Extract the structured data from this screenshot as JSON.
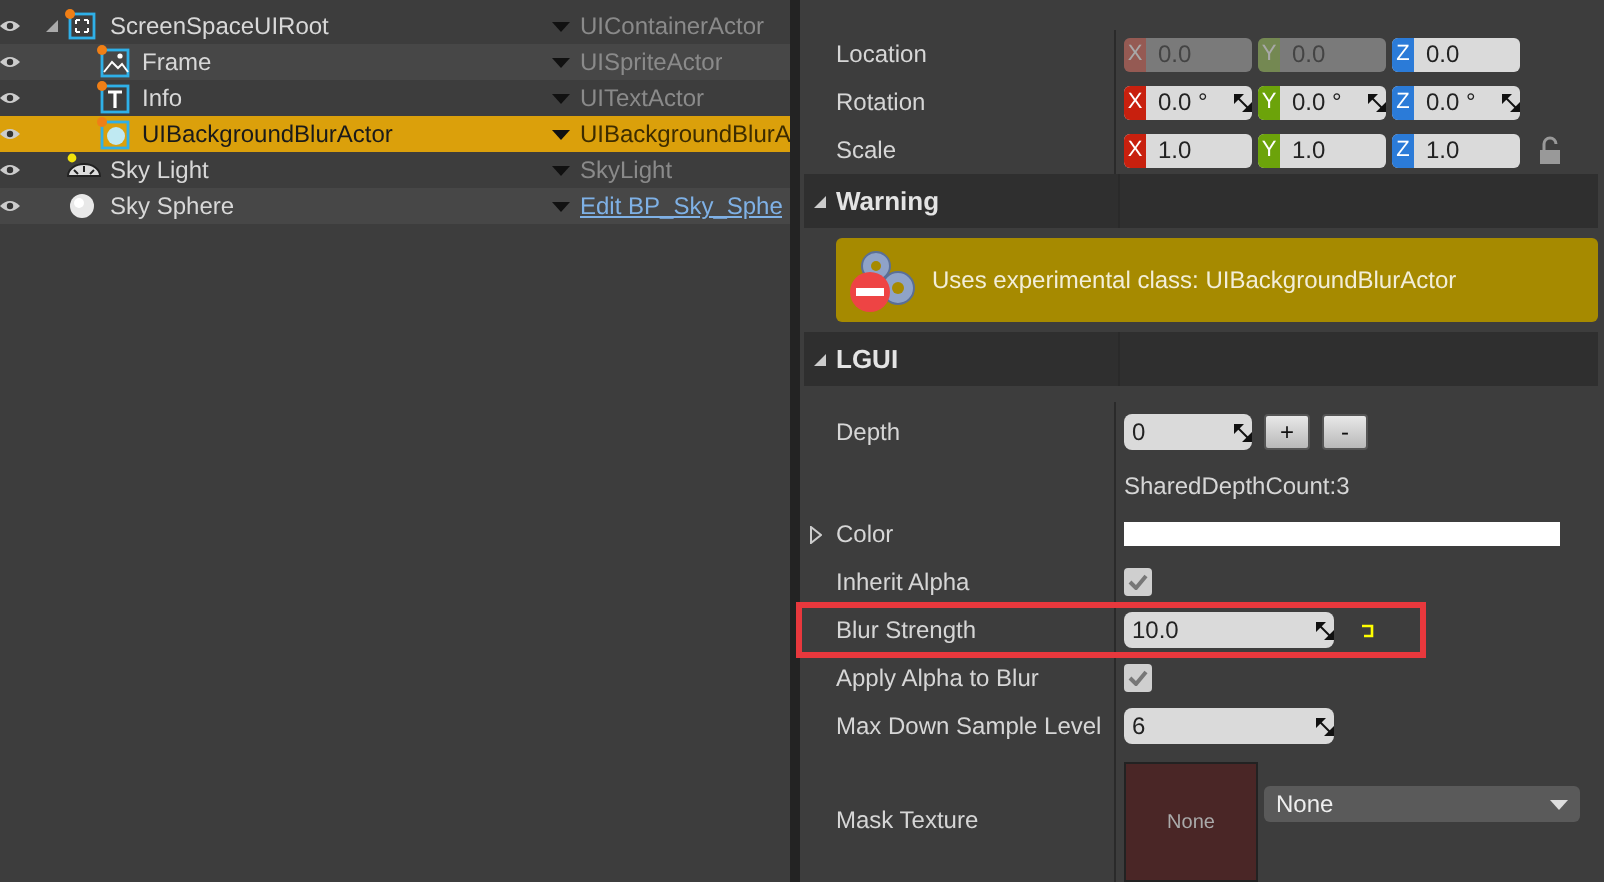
{
  "outliner": {
    "rows": [
      {
        "name": "ScreenSpaceUIRoot",
        "kind": "container",
        "type": "UIContainerActor",
        "type_is_link": false,
        "selected": false,
        "expanded": true,
        "children": [
          {
            "name": "Frame",
            "kind": "sprite",
            "type": "UISpriteActor",
            "type_is_link": false,
            "selected": false
          },
          {
            "name": "Info",
            "kind": "text",
            "type": "UITextActor",
            "type_is_link": false,
            "selected": false
          },
          {
            "name": "UIBackgroundBlurActor",
            "kind": "blur",
            "type": "UIBackgroundBlurA",
            "type_is_link": false,
            "selected": true
          }
        ]
      },
      {
        "name": "Sky Light",
        "kind": "skylight",
        "type": "SkyLight",
        "type_is_link": false,
        "selected": false
      },
      {
        "name": "Sky Sphere",
        "kind": "sphere",
        "type": "Edit BP_Sky_Sphe",
        "type_is_link": true,
        "selected": false
      }
    ]
  },
  "transform": {
    "rows": [
      {
        "label": "Location",
        "spin": false,
        "fields": [
          {
            "axis": "X",
            "value": "0.0",
            "disabled": true
          },
          {
            "axis": "Y",
            "value": "0.0",
            "disabled": true
          },
          {
            "axis": "Z",
            "value": "0.0",
            "disabled": false
          }
        ]
      },
      {
        "label": "Rotation",
        "spin": true,
        "fields": [
          {
            "axis": "X",
            "value": "0.0 °",
            "disabled": false
          },
          {
            "axis": "Y",
            "value": "0.0 °",
            "disabled": false
          },
          {
            "axis": "Z",
            "value": "0.0 °",
            "disabled": false
          }
        ]
      },
      {
        "label": "Scale",
        "spin": false,
        "locked": false,
        "fields": [
          {
            "axis": "X",
            "value": "1.0",
            "disabled": false
          },
          {
            "axis": "Y",
            "value": "1.0",
            "disabled": false
          },
          {
            "axis": "Z",
            "value": "1.0",
            "disabled": false
          }
        ]
      }
    ]
  },
  "warning": {
    "title": "Warning",
    "expanded": true,
    "message": "Uses experimental class: UIBackgroundBlurActor"
  },
  "lgui": {
    "title": "LGUI",
    "expanded": true,
    "properties": [
      {
        "kind": "depth",
        "label": "Depth",
        "value": "0",
        "buttons": [
          "+",
          "-"
        ]
      },
      {
        "kind": "note",
        "text": "SharedDepthCount:3"
      },
      {
        "kind": "color",
        "label": "Color",
        "expanded": false,
        "color": "#ffffff"
      },
      {
        "kind": "checkbox",
        "label": "Inherit Alpha",
        "checked": true
      },
      {
        "kind": "number",
        "label": "Blur Strength",
        "value": "10.0",
        "highlighted": true,
        "reset": true
      },
      {
        "kind": "checkbox",
        "label": "Apply Alpha to Blur",
        "checked": true
      },
      {
        "kind": "number",
        "label": "Max Down Sample Level",
        "value": "6",
        "highlighted": false,
        "reset": false
      },
      {
        "kind": "texture",
        "label": "Mask Texture",
        "thumb": "None",
        "dropdown": "None"
      }
    ]
  }
}
